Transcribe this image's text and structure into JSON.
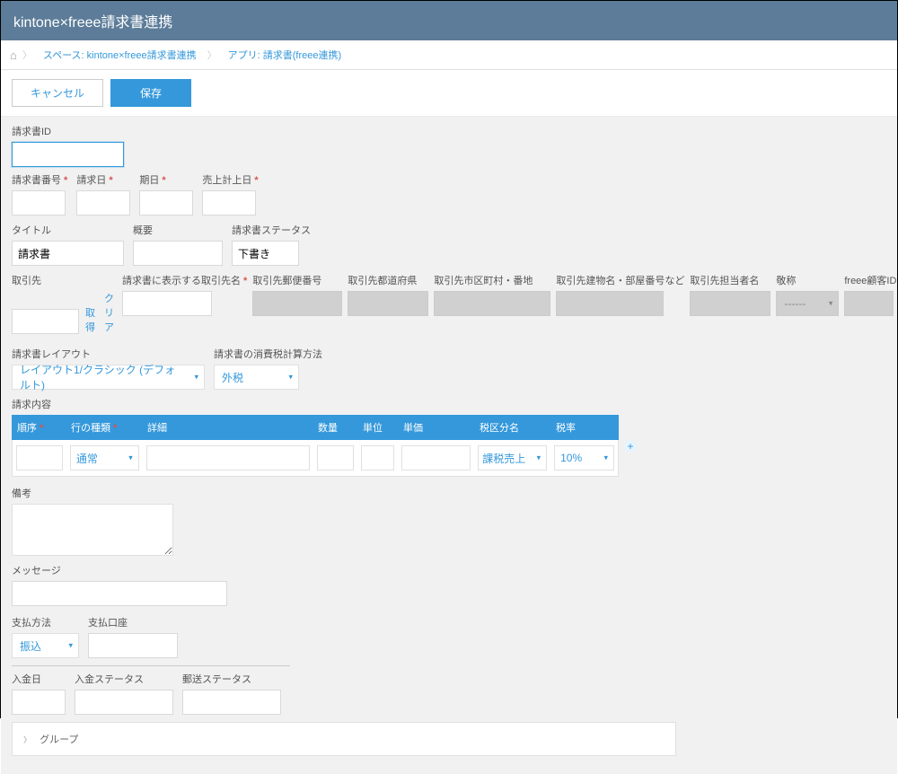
{
  "header": {
    "title": "kintone×freee請求書連携"
  },
  "breadcrumb": {
    "space": "スペース: kintone×freee請求書連携",
    "app": "アプリ: 請求書(freee連携)"
  },
  "actions": {
    "cancel": "キャンセル",
    "save": "保存"
  },
  "fields": {
    "invoice_id": {
      "label": "請求書ID",
      "value": ""
    },
    "invoice_number": {
      "label": "請求書番号",
      "value": ""
    },
    "invoice_date": {
      "label": "請求日",
      "value": ""
    },
    "due_date": {
      "label": "期日",
      "value": ""
    },
    "sales_date": {
      "label": "売上計上日",
      "value": ""
    },
    "title": {
      "label": "タイトル",
      "value": "請求書"
    },
    "outline": {
      "label": "概要",
      "value": ""
    },
    "status": {
      "label": "請求書ステータス",
      "value": "下書き"
    },
    "partner": {
      "label": "取引先",
      "value": ""
    },
    "partner_display": {
      "label": "請求書に表示する取引先名",
      "value": ""
    },
    "partner_postal": {
      "label": "取引先郵便番号",
      "value": ""
    },
    "partner_pref": {
      "label": "取引先都道府県",
      "value": ""
    },
    "partner_city": {
      "label": "取引先市区町村・番地",
      "value": ""
    },
    "partner_building": {
      "label": "取引先建物名・部屋番号など",
      "value": ""
    },
    "partner_contact": {
      "label": "取引先担当者名",
      "value": ""
    },
    "honorific": {
      "label": "敬称",
      "value": "------"
    },
    "freee_customer_id": {
      "label": "freee顧客ID",
      "value": ""
    },
    "layout": {
      "label": "請求書レイアウト",
      "value": "レイアウト1/クラシック (デフォルト)"
    },
    "tax_calc": {
      "label": "請求書の消費税計算方法",
      "value": "外税"
    },
    "remarks": {
      "label": "備考",
      "value": ""
    },
    "message": {
      "label": "メッセージ",
      "value": ""
    },
    "payment_method": {
      "label": "支払方法",
      "value": "振込"
    },
    "payment_account": {
      "label": "支払口座",
      "value": ""
    },
    "payment_date": {
      "label": "入金日",
      "value": ""
    },
    "payment_status": {
      "label": "入金ステータス",
      "value": ""
    },
    "send_status": {
      "label": "郵送ステータス",
      "value": ""
    }
  },
  "actions2": {
    "lookup": "取得",
    "clear": "クリア"
  },
  "table": {
    "title": "請求内容",
    "headers": {
      "order": "順序",
      "type": "行の種類",
      "detail": "詳細",
      "qty": "数量",
      "unit": "単位",
      "price": "単価",
      "taxname": "税区分名",
      "taxrate": "税率"
    },
    "row": {
      "type": "通常",
      "taxname": "課税売上",
      "taxrate": "10%"
    }
  },
  "group": {
    "label": "グループ"
  }
}
